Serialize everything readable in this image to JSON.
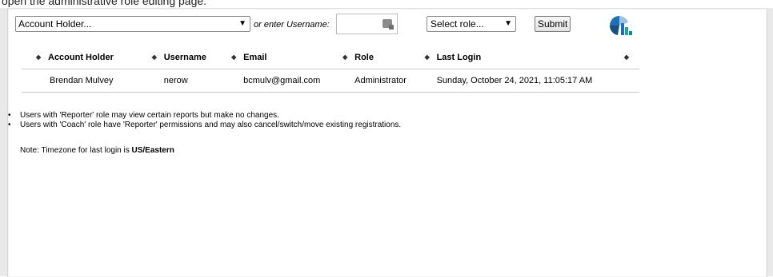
{
  "caption": "open the administrative role editing page.",
  "filters": {
    "account_select_value": "Account Holder...",
    "or_label": "or enter Username:",
    "username_value": "",
    "role_select_value": "Select role...",
    "submit_label": "Submit"
  },
  "table": {
    "headers": {
      "account_holder": "Account Holder",
      "username": "Username",
      "email": "Email",
      "role": "Role",
      "last_login": "Last Login"
    },
    "rows": [
      {
        "account_holder": "Brendan Mulvey",
        "username": "nerow",
        "email": "bcmulv@gmail.com",
        "role": "Administrator",
        "last_login": "Sunday, October 24, 2021, 11:05:17 AM"
      }
    ]
  },
  "notes": [
    "Users with 'Reporter' role may view certain reports but make no changes.",
    "Users with 'Coach' role have 'Reporter' permissions and may also cancel/switch/move existing registrations."
  ],
  "timezone_note": {
    "prefix": "Note: Timezone for last login is ",
    "zone": "US/Eastern"
  },
  "icons": {
    "sort": "sort-icon",
    "dropdown": "chevron-down-icon",
    "keyboard": "keyboard-icon",
    "logo": "brand-logo"
  },
  "colors": {
    "logo_blue": "#1f6fb5",
    "logo_teal": "#1aa6a6",
    "logo_light": "#9cc3e6"
  }
}
